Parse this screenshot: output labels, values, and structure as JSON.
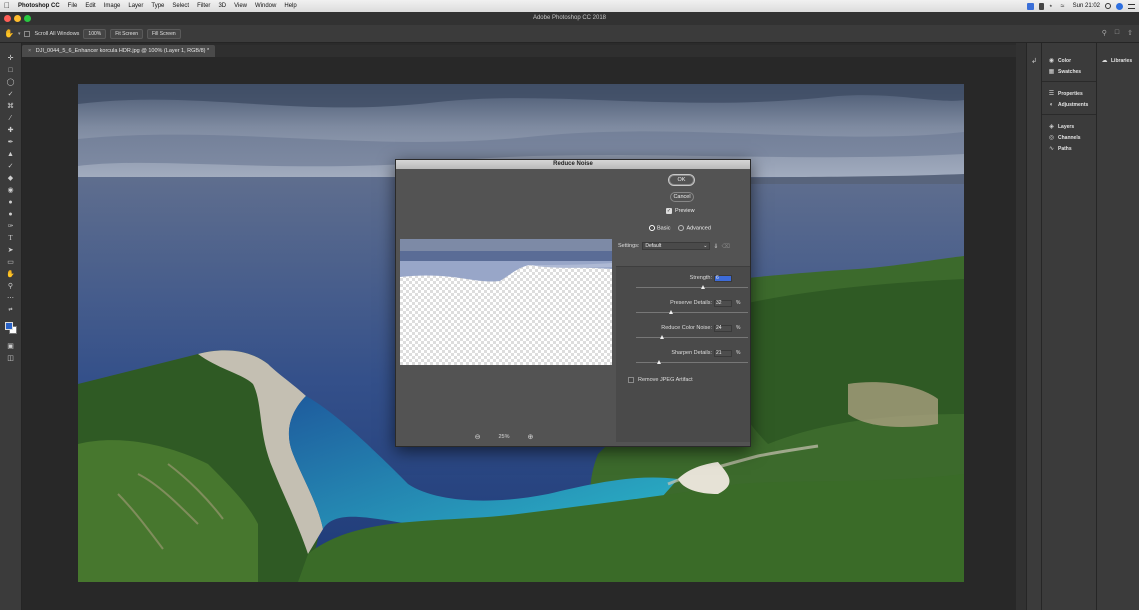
{
  "menubar": {
    "app_name": "Photoshop CC",
    "items": [
      "File",
      "Edit",
      "Image",
      "Layer",
      "Type",
      "Select",
      "Filter",
      "3D",
      "View",
      "Window",
      "Help"
    ],
    "clock": "Sun 21:02"
  },
  "window": {
    "title": "Adobe Photoshop CC 2018"
  },
  "options_bar": {
    "scroll_all_label": "Scroll All Windows",
    "zoom_100_label": "100%",
    "fit_screen_label": "Fit Screen",
    "fill_screen_label": "Fill Screen"
  },
  "document": {
    "tab_title": "DJI_0044_5_6_Enhancer korcula HDR.jpg @ 100% (Layer 1, RGB/8) *"
  },
  "panels": {
    "group1": [
      "Color",
      "Swatches"
    ],
    "group2": [
      "Properties",
      "Adjustments"
    ],
    "group3": [
      "Layers",
      "Channels",
      "Paths"
    ],
    "libraries": "Libraries"
  },
  "dialog": {
    "title": "Reduce Noise",
    "ok_label": "OK",
    "cancel_label": "Cancel",
    "preview_label": "Preview",
    "preview_checked": true,
    "mode_basic": "Basic",
    "mode_advanced": "Advanced",
    "mode_selected": "Basic",
    "settings_label": "Settings:",
    "settings_value": "Default",
    "strength_label": "Strength:",
    "strength_value": "6",
    "strength_max": 10,
    "preserve_label": "Preserve Details:",
    "preserve_value": "32",
    "reduce_color_label": "Reduce Color Noise:",
    "reduce_color_value": "24",
    "sharpen_label": "Sharpen Details:",
    "sharpen_value": "21",
    "percent": "%",
    "jpeg_label": "Remove JPEG Artifact",
    "jpeg_checked": false,
    "zoom_value": "25%"
  }
}
